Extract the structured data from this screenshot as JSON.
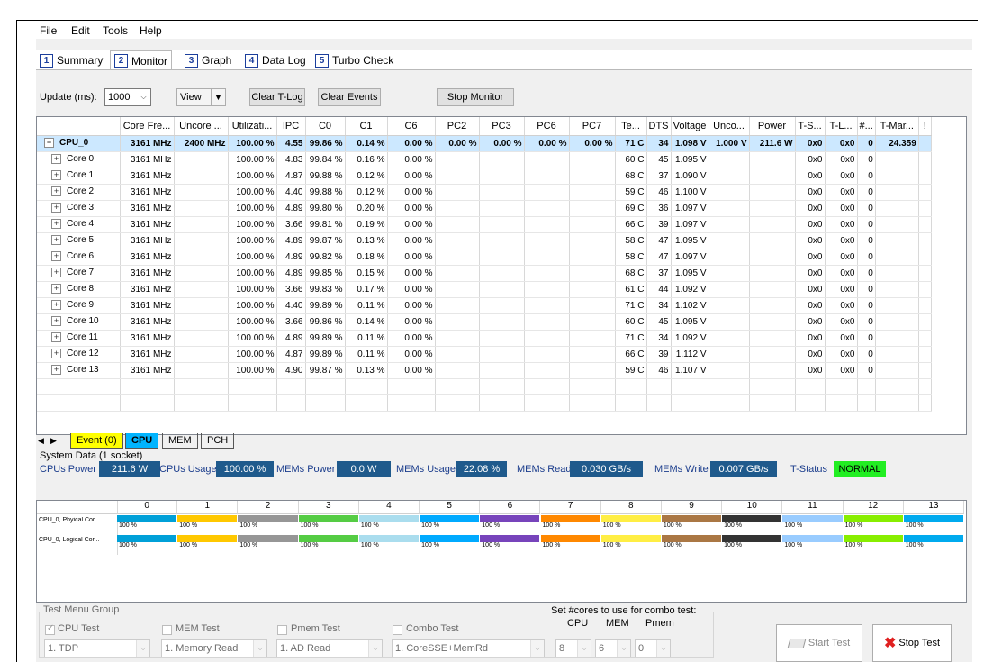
{
  "menu": [
    "File",
    "Edit",
    "Tools",
    "Help"
  ],
  "tabs": [
    {
      "num": "1",
      "label": "Summary"
    },
    {
      "num": "2",
      "label": "Monitor"
    },
    {
      "num": "3",
      "label": "Graph"
    },
    {
      "num": "4",
      "label": "Data Log"
    },
    {
      "num": "5",
      "label": "Turbo Check"
    }
  ],
  "toolbar": {
    "update_label": "Update (ms):",
    "update_value": "1000",
    "view_label": "View",
    "clear_tlog": "Clear T-Log",
    "clear_events": "Clear Events",
    "stop_monitor": "Stop Monitor"
  },
  "columns": [
    "",
    "Core Fre...",
    "Uncore ...",
    "Utilizati...",
    "IPC",
    "C0",
    "C1",
    "C6",
    "PC2",
    "PC3",
    "PC6",
    "PC7",
    "Te...",
    "DTS",
    "Voltage",
    "Unco...",
    "Power",
    "T-S...",
    "T-L...",
    "#...",
    "T-Mar...",
    "!"
  ],
  "cpu_row": [
    "CPU_0",
    "3161 MHz",
    "2400 MHz",
    "100.00 %",
    "4.55",
    "99.86 %",
    "0.14 %",
    "0.00 %",
    "0.00 %",
    "0.00 %",
    "0.00 %",
    "0.00 %",
    "71 C",
    "34",
    "1.098 V",
    "1.000 V",
    "211.6 W",
    "0x0",
    "0x0",
    "0",
    "24.359",
    ""
  ],
  "core_rows": [
    [
      "Core 0",
      "3161 MHz",
      "",
      "100.00 %",
      "4.83",
      "99.84 %",
      "0.16 %",
      "0.00 %",
      "",
      "",
      "",
      "",
      "60 C",
      "45",
      "1.095 V",
      "",
      "",
      "0x0",
      "0x0",
      "0",
      "",
      ""
    ],
    [
      "Core 1",
      "3161 MHz",
      "",
      "100.00 %",
      "4.87",
      "99.88 %",
      "0.12 %",
      "0.00 %",
      "",
      "",
      "",
      "",
      "68 C",
      "37",
      "1.090 V",
      "",
      "",
      "0x0",
      "0x0",
      "0",
      "",
      ""
    ],
    [
      "Core 2",
      "3161 MHz",
      "",
      "100.00 %",
      "4.40",
      "99.88 %",
      "0.12 %",
      "0.00 %",
      "",
      "",
      "",
      "",
      "59 C",
      "46",
      "1.100 V",
      "",
      "",
      "0x0",
      "0x0",
      "0",
      "",
      ""
    ],
    [
      "Core 3",
      "3161 MHz",
      "",
      "100.00 %",
      "4.89",
      "99.80 %",
      "0.20 %",
      "0.00 %",
      "",
      "",
      "",
      "",
      "69 C",
      "36",
      "1.097 V",
      "",
      "",
      "0x0",
      "0x0",
      "0",
      "",
      ""
    ],
    [
      "Core 4",
      "3161 MHz",
      "",
      "100.00 %",
      "3.66",
      "99.81 %",
      "0.19 %",
      "0.00 %",
      "",
      "",
      "",
      "",
      "66 C",
      "39",
      "1.097 V",
      "",
      "",
      "0x0",
      "0x0",
      "0",
      "",
      ""
    ],
    [
      "Core 5",
      "3161 MHz",
      "",
      "100.00 %",
      "4.89",
      "99.87 %",
      "0.13 %",
      "0.00 %",
      "",
      "",
      "",
      "",
      "58 C",
      "47",
      "1.095 V",
      "",
      "",
      "0x0",
      "0x0",
      "0",
      "",
      ""
    ],
    [
      "Core 6",
      "3161 MHz",
      "",
      "100.00 %",
      "4.89",
      "99.82 %",
      "0.18 %",
      "0.00 %",
      "",
      "",
      "",
      "",
      "58 C",
      "47",
      "1.097 V",
      "",
      "",
      "0x0",
      "0x0",
      "0",
      "",
      ""
    ],
    [
      "Core 7",
      "3161 MHz",
      "",
      "100.00 %",
      "4.89",
      "99.85 %",
      "0.15 %",
      "0.00 %",
      "",
      "",
      "",
      "",
      "68 C",
      "37",
      "1.095 V",
      "",
      "",
      "0x0",
      "0x0",
      "0",
      "",
      ""
    ],
    [
      "Core 8",
      "3161 MHz",
      "",
      "100.00 %",
      "3.66",
      "99.83 %",
      "0.17 %",
      "0.00 %",
      "",
      "",
      "",
      "",
      "61 C",
      "44",
      "1.092 V",
      "",
      "",
      "0x0",
      "0x0",
      "0",
      "",
      ""
    ],
    [
      "Core 9",
      "3161 MHz",
      "",
      "100.00 %",
      "4.40",
      "99.89 %",
      "0.11 %",
      "0.00 %",
      "",
      "",
      "",
      "",
      "71 C",
      "34",
      "1.102 V",
      "",
      "",
      "0x0",
      "0x0",
      "0",
      "",
      ""
    ],
    [
      "Core 10",
      "3161 MHz",
      "",
      "100.00 %",
      "3.66",
      "99.86 %",
      "0.14 %",
      "0.00 %",
      "",
      "",
      "",
      "",
      "60 C",
      "45",
      "1.095 V",
      "",
      "",
      "0x0",
      "0x0",
      "0",
      "",
      ""
    ],
    [
      "Core 11",
      "3161 MHz",
      "",
      "100.00 %",
      "4.89",
      "99.89 %",
      "0.11 %",
      "0.00 %",
      "",
      "",
      "",
      "",
      "71 C",
      "34",
      "1.092 V",
      "",
      "",
      "0x0",
      "0x0",
      "0",
      "",
      ""
    ],
    [
      "Core 12",
      "3161 MHz",
      "",
      "100.00 %",
      "4.87",
      "99.89 %",
      "0.11 %",
      "0.00 %",
      "",
      "",
      "",
      "",
      "66 C",
      "39",
      "1.112 V",
      "",
      "",
      "0x0",
      "0x0",
      "0",
      "",
      ""
    ],
    [
      "Core 13",
      "3161 MHz",
      "",
      "100.00 %",
      "4.90",
      "99.87 %",
      "0.13 %",
      "0.00 %",
      "",
      "",
      "",
      "",
      "59 C",
      "46",
      "1.107 V",
      "",
      "",
      "0x0",
      "0x0",
      "0",
      "",
      ""
    ]
  ],
  "sheet_tabs": [
    {
      "label": "Event (0)",
      "color": "#ffff00"
    },
    {
      "label": "CPU",
      "color": "#00b4ff"
    },
    {
      "label": "MEM",
      "color": "#ffffff"
    },
    {
      "label": "PCH",
      "color": "#ffffff"
    }
  ],
  "system": {
    "title": "System Data (1 socket)",
    "items": [
      {
        "label": "CPUs Power",
        "value": "211.6 W"
      },
      {
        "label": "CPUs Usage",
        "value": "100.00 %"
      },
      {
        "label": "MEMs Power",
        "value": "0.0 W"
      },
      {
        "label": "MEMs Usage",
        "value": "22.08 %"
      },
      {
        "label": "MEMs Read",
        "value": "0.030 GB/s"
      },
      {
        "label": "MEMs Write",
        "value": "0.007 GB/s"
      },
      {
        "label": "T-Status",
        "value": "NORMAL"
      }
    ]
  },
  "util": {
    "cores": [
      "0",
      "1",
      "2",
      "3",
      "4",
      "5",
      "6",
      "7",
      "8",
      "9",
      "10",
      "11",
      "12",
      "13"
    ],
    "colors": [
      "#00a0d8",
      "#ffc800",
      "#969696",
      "#55cc44",
      "#aaddee",
      "#00aaff",
      "#7744bb",
      "#ff8800",
      "#ffee44",
      "#aa7744",
      "#333333",
      "#99ccff",
      "#88ee00",
      "#00aaee"
    ],
    "rows": [
      {
        "label": "CPU_0, Phyical Cor...",
        "pct": "100 %"
      },
      {
        "label": "CPU_0, Logical Cor...",
        "pct": "100 %"
      }
    ]
  },
  "test": {
    "group_label": "Test Menu Group",
    "cpu_test": "CPU Test",
    "mem_test": "MEM Test",
    "pmem_test": "Pmem Test",
    "combo_test": "Combo Test",
    "cpu_combo": "1. TDP",
    "mem_combo": "1. Memory Read",
    "pmem_combo": "1. AD Read",
    "combo_combo": "1. CoreSSE+MemRd",
    "set_cores_label": "Set #cores to use for combo test:",
    "col_cpu": "CPU",
    "col_mem": "MEM",
    "col_pmem": "Pmem",
    "cpu_cores": "8",
    "mem_cores": "6",
    "pmem_cores": "0",
    "start": "Start Test",
    "stop": "Stop Test"
  }
}
